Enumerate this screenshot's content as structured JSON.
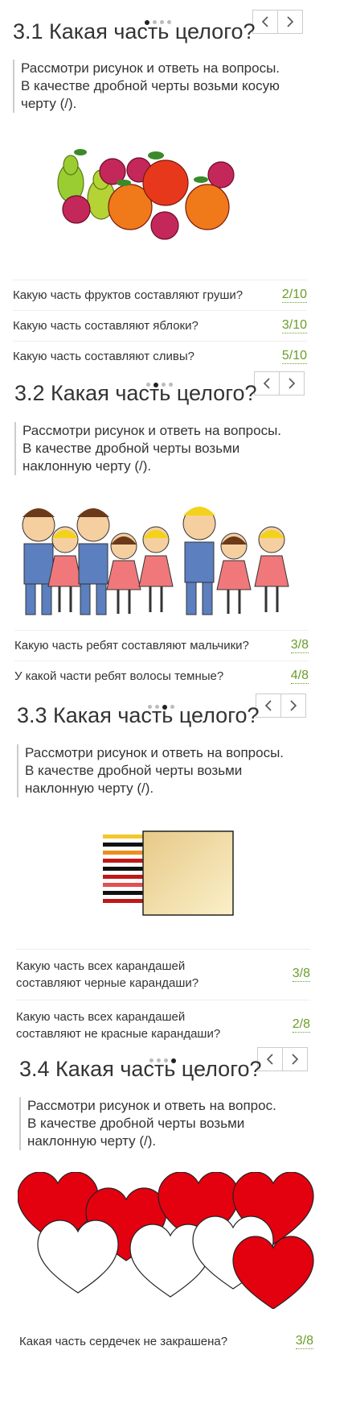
{
  "sections": [
    {
      "title": "3.1 Какая часть целого?",
      "instruction": [
        "Рассмотри рисунок и ответь на вопросы.",
        "В качестве дробной черты возьми косую",
        "черту (/)."
      ],
      "image": "fruits-image",
      "questions": [
        {
          "text": "Какую часть фруктов составляют груши?",
          "answer": "2/10"
        },
        {
          "text": "Какую часть составляют яблоки?",
          "answer": "3/10"
        },
        {
          "text": "Какую часть составляют сливы?",
          "answer": "5/10"
        }
      ]
    },
    {
      "title": "3.2 Какая часть целого?",
      "instruction": [
        "Рассмотри рисунок и ответь на вопросы.",
        "В качестве дробной черты возьми",
        "наклонную черту (/)."
      ],
      "image": "children-image",
      "questions": [
        {
          "text": "Какую часть ребят составляют мальчики?",
          "answer": "3/8"
        },
        {
          "text": "У какой части ребят волосы темные?",
          "answer": "4/8"
        }
      ]
    },
    {
      "title": "3.3 Какая часть целого?",
      "instruction": [
        "Рассмотри рисунок и ответь на вопросы.",
        "В качестве дробной черты возьми",
        "наклонную черту (/)."
      ],
      "image": "pencils-image",
      "questions": [
        {
          "text_lines": [
            "Какую часть всех карандашей",
            "составляют черные карандаши?"
          ],
          "answer": "3/8"
        },
        {
          "text_lines": [
            "Какую часть всех карандашей",
            "составляют не красные карандаши?"
          ],
          "answer": "2/8"
        }
      ]
    },
    {
      "title": "3.4 Какая часть целого?",
      "instruction": [
        "Рассмотри рисунок и ответь на вопрос.",
        "В качестве дробной черты возьми",
        "наклонную черту (/)."
      ],
      "image": "hearts-image",
      "questions": [
        {
          "text": "Какая часть сердечек не закрашена?",
          "answer": "3/8"
        }
      ]
    }
  ],
  "colors": {
    "answer": "#6a9d2a",
    "heart_red": "#e3000f",
    "border": "#cccccc"
  },
  "icons": {
    "prev": "chevron-left-icon",
    "next": "chevron-right-icon"
  }
}
